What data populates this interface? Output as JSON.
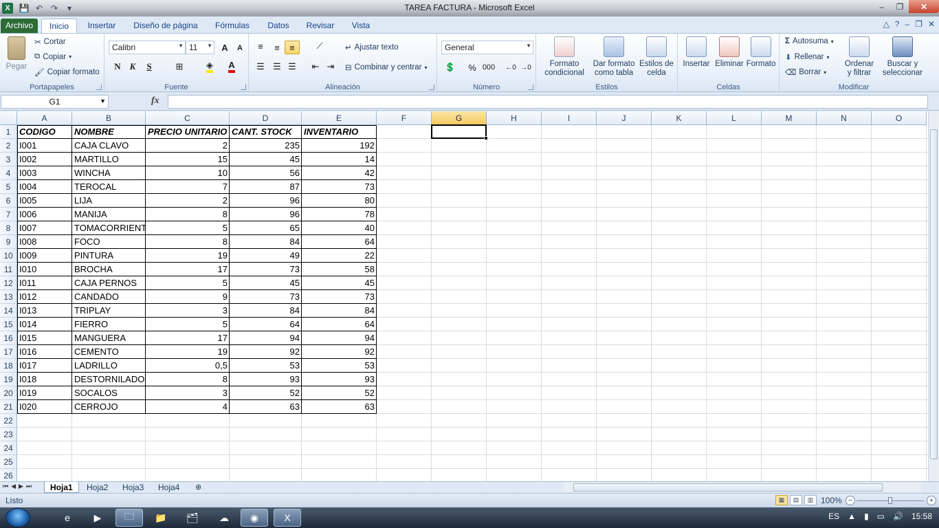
{
  "window": {
    "title": "TAREA FACTURA  -  Microsoft Excel",
    "controls": {
      "minimize": "–",
      "maximize": "❐",
      "close": "✕"
    }
  },
  "qat": {
    "save_icon": "💾",
    "undo_icon": "↶",
    "redo_icon": "↷",
    "customize_icon": "▾"
  },
  "tabs": [
    {
      "label": "Archivo",
      "state": "file"
    },
    {
      "label": "Inicio",
      "state": "active"
    },
    {
      "label": "Insertar"
    },
    {
      "label": "Diseño de página"
    },
    {
      "label": "Fórmulas"
    },
    {
      "label": "Datos"
    },
    {
      "label": "Revisar"
    },
    {
      "label": "Vista"
    }
  ],
  "tabs_right": {
    "caret": "△",
    "help": "?",
    "min": "–",
    "restore": "❐",
    "close": "✕"
  },
  "ribbon": {
    "portapapeles": {
      "paste": "Pegar",
      "cut": "Cortar",
      "copy": "Copiar",
      "format_painter": "Copiar formato",
      "label": "Portapapeles"
    },
    "fuente": {
      "font_name": "Calibri",
      "font_size": "11",
      "grow": "A",
      "shrink": "A",
      "bold": "N",
      "italic": "K",
      "underline": "S",
      "label": "Fuente"
    },
    "alineacion": {
      "wrap": "Ajustar texto",
      "merge": "Combinar y centrar",
      "label": "Alineación"
    },
    "numero": {
      "format": "General",
      "percent": "%",
      "thousands": "000",
      "label": "Número"
    },
    "estilos": {
      "conditional": [
        "Formato",
        "condicional"
      ],
      "table": [
        "Dar formato",
        "como tabla"
      ],
      "cell_styles": [
        "Estilos de",
        "celda"
      ],
      "label": "Estilos"
    },
    "celdas": {
      "insert": "Insertar",
      "delete": "Eliminar",
      "format": "Formato",
      "label": "Celdas"
    },
    "modificar": {
      "autosum": "Autosuma",
      "fill": "Rellenar",
      "clear": "Borrar",
      "sort": [
        "Ordenar",
        "y filtrar"
      ],
      "find": [
        "Buscar y",
        "seleccionar"
      ],
      "label": "Modificar"
    }
  },
  "formula_bar": {
    "name_box": "G1",
    "fx": "fx",
    "formula": ""
  },
  "columns": [
    "A",
    "B",
    "C",
    "D",
    "E",
    "F",
    "G",
    "H",
    "I",
    "J",
    "K",
    "L",
    "M",
    "N",
    "O"
  ],
  "active_column": "G",
  "rows": [
    "1",
    "2",
    "3",
    "4",
    "5",
    "6",
    "7",
    "8",
    "9",
    "10",
    "11",
    "12",
    "13",
    "14",
    "15",
    "16",
    "17",
    "18",
    "19",
    "20",
    "21",
    "22",
    "23",
    "24",
    "25",
    "26"
  ],
  "table": {
    "headers": [
      "CODIGO",
      "NOMBRE",
      "PRECIO UNITARIO",
      "CANT. STOCK",
      "INVENTARIO"
    ],
    "rows": [
      [
        "I001",
        "CAJA CLAVO",
        "2",
        "235",
        "192"
      ],
      [
        "I002",
        "MARTILLO",
        "15",
        "45",
        "14"
      ],
      [
        "I003",
        "WINCHA",
        "10",
        "56",
        "42"
      ],
      [
        "I004",
        "TEROCAL",
        "7",
        "87",
        "73"
      ],
      [
        "I005",
        "LIJA",
        "2",
        "96",
        "80"
      ],
      [
        "I006",
        "MANIJA",
        "8",
        "96",
        "78"
      ],
      [
        "I007",
        "TOMACORRIENTE",
        "5",
        "65",
        "40"
      ],
      [
        "I008",
        "FOCO",
        "8",
        "84",
        "64"
      ],
      [
        "I009",
        "PINTURA",
        "19",
        "49",
        "22"
      ],
      [
        "I010",
        "BROCHA",
        "17",
        "73",
        "58"
      ],
      [
        "I011",
        "CAJA PERNOS",
        "5",
        "45",
        "45"
      ],
      [
        "I012",
        "CANDADO",
        "9",
        "73",
        "73"
      ],
      [
        "I013",
        "TRIPLAY",
        "3",
        "84",
        "84"
      ],
      [
        "I014",
        "FIERRO",
        "5",
        "64",
        "64"
      ],
      [
        "I015",
        "MANGUERA",
        "17",
        "94",
        "94"
      ],
      [
        "I016",
        "CEMENTO",
        "19",
        "92",
        "92"
      ],
      [
        "I017",
        "LADRILLO",
        "0,5",
        "53",
        "53"
      ],
      [
        "I018",
        "DESTORNILADOR",
        "8",
        "93",
        "93"
      ],
      [
        "I019",
        "SOCALOS",
        "3",
        "52",
        "52"
      ],
      [
        "I020",
        "CERROJO",
        "4",
        "63",
        "63"
      ]
    ]
  },
  "sheets": [
    "Hoja1",
    "Hoja2",
    "Hoja3",
    "Hoja4"
  ],
  "active_sheet": "Hoja1",
  "status": {
    "text": "Listo",
    "zoom": "100%",
    "zoom_out": "−",
    "zoom_in": "+"
  },
  "taskbar": {
    "lang": "ES",
    "time": "15:58"
  }
}
